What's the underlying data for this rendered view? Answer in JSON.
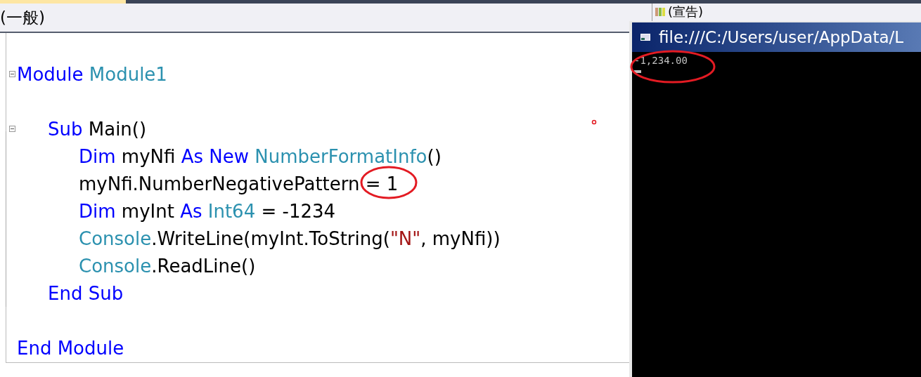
{
  "dropdowns": [
    {
      "label": "(一般)"
    },
    {
      "label": "(宣告)"
    }
  ],
  "code": {
    "header": [
      {
        "kind": "keyword",
        "text": "Module "
      },
      {
        "kind": "type",
        "text": "Module1"
      }
    ],
    "footer": [
      {
        "kind": "keyword",
        "text": "End Module"
      }
    ],
    "children": [
      {
        "header": [
          {
            "kind": "keyword",
            "text": "Sub "
          },
          {
            "kind": "plain",
            "text": "Main()"
          }
        ],
        "footer": [
          {
            "kind": "keyword",
            "text": "End Sub"
          }
        ],
        "children": [
          {
            "tokens": [
              {
                "kind": "keyword",
                "text": "Dim "
              },
              {
                "kind": "plain",
                "text": "myNfi "
              },
              {
                "kind": "keyword",
                "text": "As New "
              },
              {
                "kind": "type",
                "text": "NumberFormatInfo"
              },
              {
                "kind": "plain",
                "text": "()"
              }
            ]
          },
          {
            "tokens": [
              {
                "kind": "plain",
                "text": "myNfi.NumberNegativePattern"
              },
              {
                "kind": "plain",
                "text": " = 1",
                "circled": true
              }
            ]
          },
          {
            "tokens": [
              {
                "kind": "keyword",
                "text": "Dim "
              },
              {
                "kind": "plain",
                "text": "myInt "
              },
              {
                "kind": "keyword",
                "text": "As "
              },
              {
                "kind": "type",
                "text": "Int64"
              },
              {
                "kind": "plain",
                "text": " = -1234"
              }
            ]
          },
          {
            "tokens": [
              {
                "kind": "type",
                "text": "Console"
              },
              {
                "kind": "plain",
                "text": ".WriteLine(myInt.ToString("
              },
              {
                "kind": "string",
                "text": "\"N\""
              },
              {
                "kind": "plain",
                "text": ", myNfi))"
              }
            ]
          },
          {
            "tokens": [
              {
                "kind": "type",
                "text": "Console"
              },
              {
                "kind": "plain",
                "text": ".ReadLine()"
              }
            ]
          }
        ]
      }
    ]
  },
  "console": {
    "title": "file:///C:/Users/user/AppData/L",
    "output": "-1,234.00"
  }
}
